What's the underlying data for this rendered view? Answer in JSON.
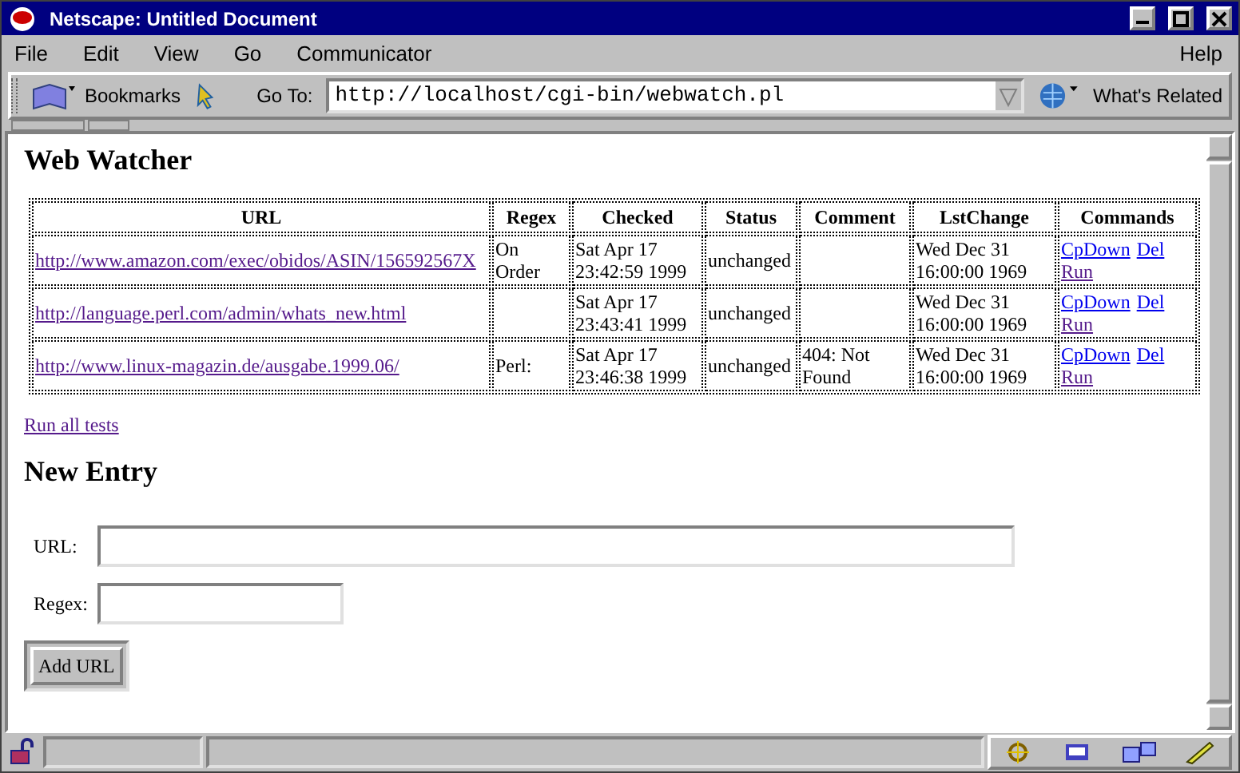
{
  "window": {
    "title": "Netscape: Untitled Document"
  },
  "menu": [
    {
      "label": "File"
    },
    {
      "label": "Edit"
    },
    {
      "label": "View"
    },
    {
      "label": "Go"
    },
    {
      "label": "Communicator"
    }
  ],
  "help_menu": {
    "label": "Help"
  },
  "toolbar": {
    "bookmarks": "Bookmarks",
    "goto_label": "Go To:",
    "address": "http://localhost/cgi-bin/webwatch.pl",
    "related": "What's Related"
  },
  "page": {
    "heading": "Web Watcher",
    "table": {
      "columns": [
        "URL",
        "Regex",
        "Checked",
        "Status",
        "Comment",
        "LstChange",
        "Commands"
      ],
      "rows": [
        {
          "url": {
            "text": "http://www.amazon.com/exec/obidos/ASIN/156592567X",
            "visited": true
          },
          "regex": "On Order",
          "checked": "Sat Apr 17 23:42:59 1999",
          "status": "unchanged",
          "comment": "",
          "lstchange": "Wed Dec 31 16:00:00 1969",
          "commands": [
            {
              "text": "CpDown",
              "visited": false
            },
            {
              "text": "Del",
              "visited": false
            },
            {
              "text": "Run",
              "visited": true
            }
          ]
        },
        {
          "url": {
            "text": "http://language.perl.com/admin/whats_new.html",
            "visited": true
          },
          "regex": "",
          "checked": "Sat Apr 17 23:43:41 1999",
          "status": "unchanged",
          "comment": "",
          "lstchange": "Wed Dec 31 16:00:00 1969",
          "commands": [
            {
              "text": "CpDown",
              "visited": false
            },
            {
              "text": "Del",
              "visited": false
            },
            {
              "text": "Run",
              "visited": true
            }
          ]
        },
        {
          "url": {
            "text": "http://www.linux-magazin.de/ausgabe.1999.06/",
            "visited": true
          },
          "regex": "Perl:",
          "checked": "Sat Apr 17 23:46:38 1999",
          "status": "unchanged",
          "comment": "404: Not Found",
          "lstchange": "Wed Dec 31 16:00:00 1969",
          "commands": [
            {
              "text": "CpDown",
              "visited": false
            },
            {
              "text": "Del",
              "visited": false
            },
            {
              "text": "Run",
              "visited": true
            }
          ]
        }
      ]
    },
    "run_all": {
      "text": "Run all tests",
      "visited": true
    },
    "form_heading": "New Entry",
    "fields": [
      {
        "label": "URL:",
        "wide": true
      },
      {
        "label": "Regex:",
        "wide": false
      }
    ],
    "submit": "Add URL"
  }
}
